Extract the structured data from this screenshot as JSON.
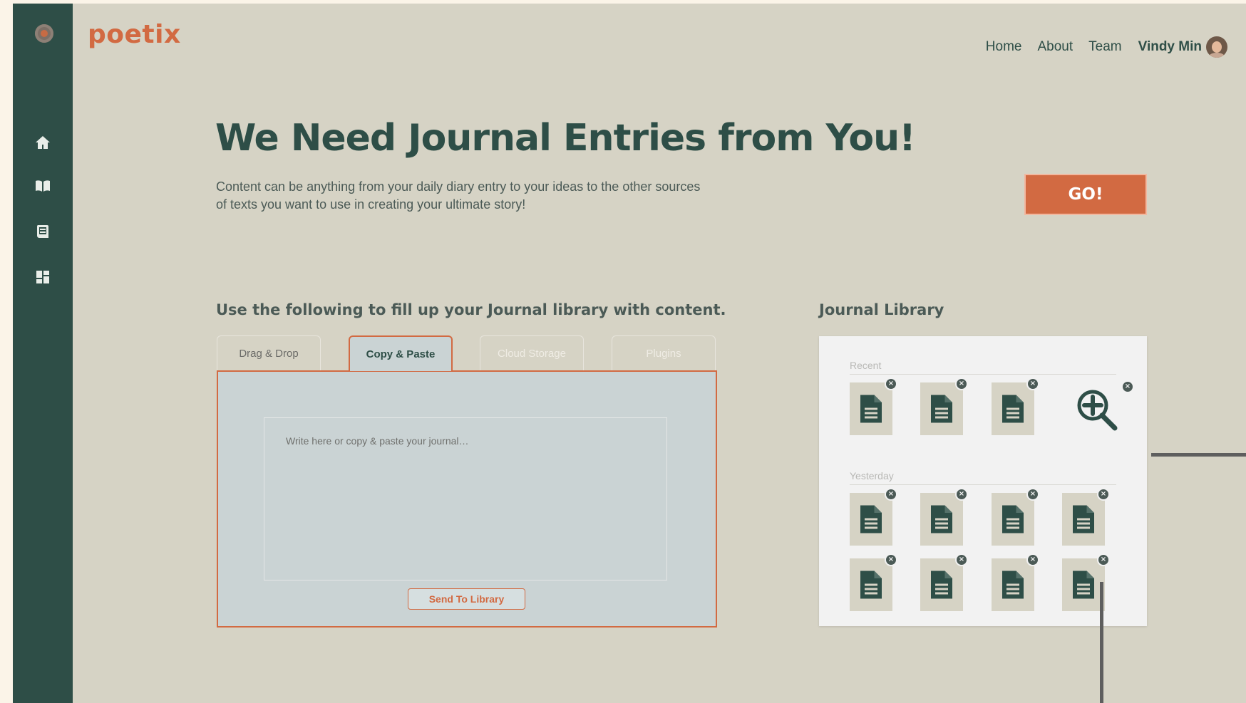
{
  "brand": {
    "name": "poetix",
    "accent": "#d26a42",
    "dark": "#2e4e47",
    "background": "#d6d3c5"
  },
  "nav": {
    "items": [
      "Home",
      "About",
      "Team"
    ],
    "user": "Vindy Min"
  },
  "sidebar": {
    "icons": [
      "home-icon",
      "book-open-icon",
      "notebook-icon",
      "dashboard-icon"
    ]
  },
  "hero": {
    "title": "We Need Journal Entries from You!",
    "subtitle": "Content can be anything from your daily diary entry to your ideas to the other sources of texts you want to use in creating your ultimate story!",
    "go_button": "GO!"
  },
  "input_section": {
    "title": "Use the following to fill up your Journal library with content.",
    "tabs": [
      "Drag & Drop",
      "Copy & Paste",
      "Cloud Storage",
      "Plugins"
    ],
    "active_tab": "Copy & Paste",
    "textarea_placeholder": "Write here or copy & paste your journal…",
    "send_button": "Send To Library"
  },
  "library": {
    "title": "Journal Library",
    "recent_label": "Recent",
    "yesterday_label": "Yesterday",
    "recent_count": 3,
    "yesterday_count": 8
  }
}
